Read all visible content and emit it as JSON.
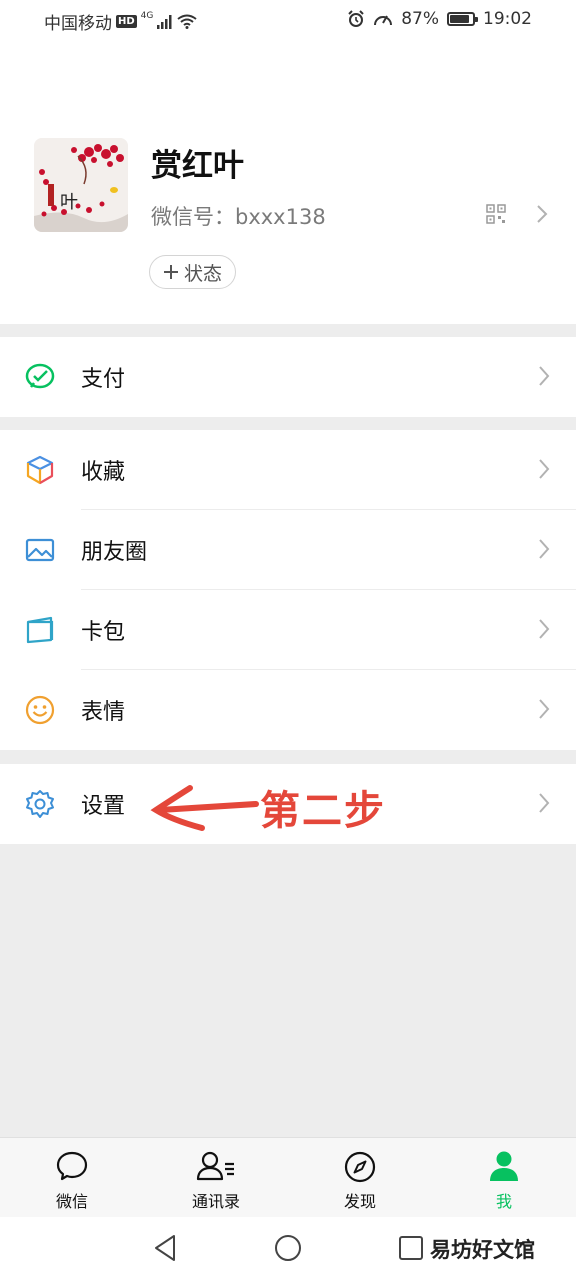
{
  "status_bar": {
    "carrier": "中国移动",
    "hd": "HD",
    "network": "4G",
    "battery": "87%",
    "battery_level": 0.87,
    "time": "19:02"
  },
  "profile": {
    "avatar_text": "叶",
    "nickname": "赏红叶",
    "wechat_id": "微信号：bxxx138",
    "status_button": "状态"
  },
  "menu": {
    "pay": "支付",
    "favorites": "收藏",
    "moments": "朋友圈",
    "cards": "卡包",
    "stickers": "表情",
    "settings": "设置"
  },
  "annotation": "第二步",
  "tabs": [
    "微信",
    "通讯录",
    "发现",
    "我"
  ],
  "active_tab": 3,
  "watermark": "易坊好文馆",
  "colors": {
    "accent": "#07c160",
    "annotation_red": "#e4473a",
    "background": "#ededed"
  }
}
